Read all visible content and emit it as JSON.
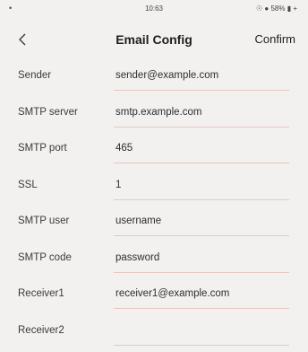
{
  "status_bar": {
    "left_glyph": "•",
    "time": "10:63",
    "right": "☉ ● 58% ▮ +"
  },
  "nav": {
    "title": "Email Config",
    "confirm_label": "Confirm",
    "back_icon": "chevron-left-icon"
  },
  "fields": [
    {
      "label": "Sender",
      "value": "sender@example.com"
    },
    {
      "label": "SMTP server",
      "value": "smtp.example.com"
    },
    {
      "label": "SMTP port",
      "value": "465"
    },
    {
      "label": "SSL",
      "value": "1"
    },
    {
      "label": "SMTP user",
      "value": "username"
    },
    {
      "label": "SMTP code",
      "value": "password"
    },
    {
      "label": "Receiver1",
      "value": "receiver1@example.com"
    },
    {
      "label": "Receiver2",
      "value": ""
    }
  ],
  "colors": {
    "background": "#f2f1f0",
    "underline": "#e6c8bf"
  }
}
